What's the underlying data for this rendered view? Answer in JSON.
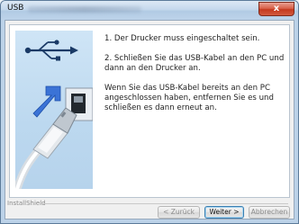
{
  "window": {
    "title": "USB",
    "close_label": "x"
  },
  "instructions": [
    "1. Der Drucker muss eingeschaltet sein.",
    "2. Schließen Sie das USB-Kabel an den PC und dann an den Drucker an.",
    "Wenn Sie das USB-Kabel bereits an den PC angeschlossen haben, entfernen Sie es und schließen es dann erneut an."
  ],
  "footer": {
    "brand": "InstallShield",
    "back_label": "< Zurück",
    "next_label": "Weiter >",
    "cancel_label": "Abbrechen"
  },
  "colors": {
    "art_background": "#c3dcf1",
    "usb_symbol": "#1a3a66",
    "arrow_blue": "#3b73d6"
  }
}
